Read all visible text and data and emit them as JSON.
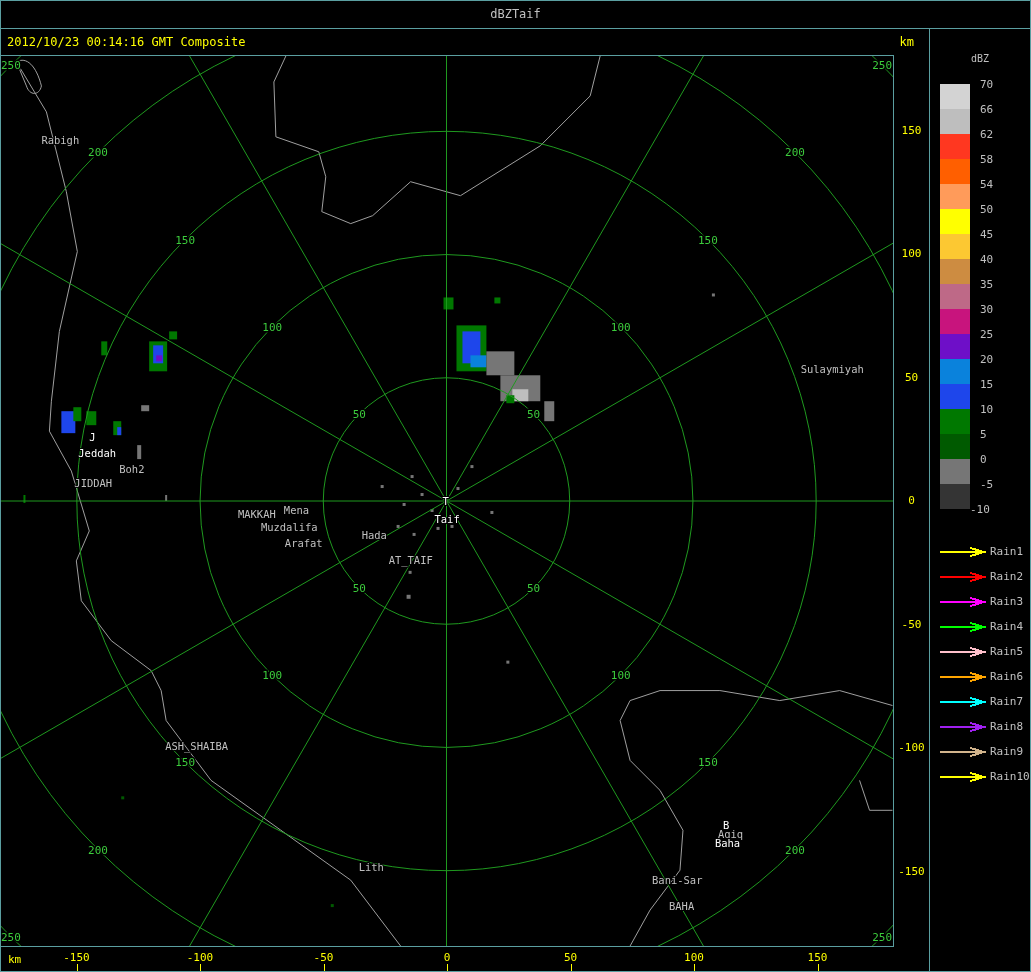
{
  "window": {
    "title": "dBZTaif"
  },
  "header": {
    "timestamp": "2012/10/23 00:14:16 GMT Composite",
    "unit": "km"
  },
  "range_rings": [
    {
      "labels": [
        "50",
        "50",
        "50",
        "50"
      ]
    },
    {
      "labels": [
        "100",
        "100",
        "100",
        "100"
      ]
    },
    {
      "labels": [
        "150",
        "150",
        "150",
        "150"
      ]
    },
    {
      "labels": [
        "200",
        "200",
        "200",
        "200"
      ]
    },
    {
      "labels": [
        "250",
        "250",
        "250",
        "250"
      ]
    }
  ],
  "places": [
    {
      "name": "Rabigh",
      "kind": "town"
    },
    {
      "name": "J",
      "kind": "station"
    },
    {
      "name": "Jeddah",
      "kind": "station"
    },
    {
      "name": "Boh2",
      "kind": "town"
    },
    {
      "name": "JIDDAH",
      "kind": "town"
    },
    {
      "name": "MAKKAH",
      "kind": "town"
    },
    {
      "name": "Mena",
      "kind": "town"
    },
    {
      "name": "Muzdalifa",
      "kind": "town"
    },
    {
      "name": "Arafat",
      "kind": "town"
    },
    {
      "name": "Hada",
      "kind": "town"
    },
    {
      "name": "AT_TAIF",
      "kind": "town"
    },
    {
      "name": "T",
      "kind": "station"
    },
    {
      "name": "Taif",
      "kind": "station"
    },
    {
      "name": "Sulaymiyah",
      "kind": "town"
    },
    {
      "name": "ASH_SHAIBA",
      "kind": "town"
    },
    {
      "name": "Lith",
      "kind": "town"
    },
    {
      "name": "B",
      "kind": "station"
    },
    {
      "name": "Aqiq",
      "kind": "town"
    },
    {
      "name": "Baha",
      "kind": "station"
    },
    {
      "name": "Bani-Sar",
      "kind": "town"
    },
    {
      "name": "BAHA",
      "kind": "town"
    }
  ],
  "right_axis": {
    "ticks": [
      "150",
      "100",
      "50",
      "0",
      "-50",
      "-100",
      "-150"
    ]
  },
  "bottom_axis": {
    "unit": "km",
    "ticks": [
      "-150",
      "-100",
      "-50",
      "0",
      "50",
      "100",
      "150"
    ]
  },
  "dbz_legend": {
    "title": "dBZ",
    "min_label": "-10",
    "bins": [
      {
        "label": "70",
        "color": "#d3d3d3"
      },
      {
        "label": "66",
        "color": "#bebebe"
      },
      {
        "label": "62",
        "color": "#ff3720"
      },
      {
        "label": "58",
        "color": "#ff5f00"
      },
      {
        "label": "54",
        "color": "#ff9b5a"
      },
      {
        "label": "50",
        "color": "#ffff00"
      },
      {
        "label": "45",
        "color": "#fcc832"
      },
      {
        "label": "40",
        "color": "#cd8c41"
      },
      {
        "label": "35",
        "color": "#be6987"
      },
      {
        "label": "30",
        "color": "#c8147d"
      },
      {
        "label": "25",
        "color": "#6e0fc8"
      },
      {
        "label": "20",
        "color": "#0a82dc"
      },
      {
        "label": "15",
        "color": "#1e46eb"
      },
      {
        "label": "10",
        "color": "#007800"
      },
      {
        "label": "5",
        "color": "#005a00"
      },
      {
        "label": "0",
        "color": "#767676"
      },
      {
        "label": "-5",
        "color": "#343434"
      }
    ]
  },
  "rain_legend": [
    {
      "label": "Rain1",
      "color": "#ffff00"
    },
    {
      "label": "Rain2",
      "color": "#ff0000"
    },
    {
      "label": "Rain3",
      "color": "#ff00ff"
    },
    {
      "label": "Rain4",
      "color": "#00ff00"
    },
    {
      "label": "Rain5",
      "color": "#ffc0cb"
    },
    {
      "label": "Rain6",
      "color": "#ffa500"
    },
    {
      "label": "Rain7",
      "color": "#00ffff"
    },
    {
      "label": "Rain8",
      "color": "#a020f0"
    },
    {
      "label": "Rain9",
      "color": "#d2b48c"
    },
    {
      "label": "Rain10",
      "color": "#ffff00"
    }
  ]
}
